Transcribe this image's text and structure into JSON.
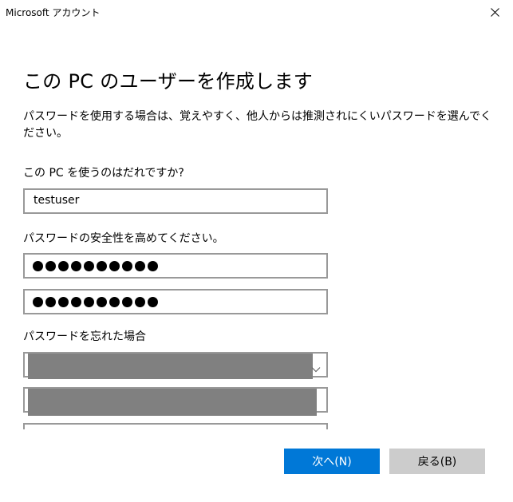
{
  "window": {
    "title": "Microsoft アカウント",
    "close_icon": "close-icon"
  },
  "page": {
    "heading": "この PC のユーザーを作成します",
    "description": "パスワードを使用する場合は、覚えやすく、他人からは推測されにくいパスワードを選んでください。"
  },
  "user": {
    "label": "この PC を使うのはだれですか?",
    "username_value": "testuser"
  },
  "password": {
    "label": "パスワードの安全性を高めてください。",
    "password_mask": "●●●●●●●●●●",
    "confirm_mask": "●●●●●●●●●●"
  },
  "recovery": {
    "label": "パスワードを忘れた場合",
    "question_icon": "chevron-down-icon"
  },
  "buttons": {
    "next_label": "次へ(N)",
    "back_label": "戻る(B)"
  },
  "colors": {
    "primary_button": "#0078d7",
    "secondary_button": "#cccccc",
    "field_border": "#999999",
    "redaction": "#808080"
  }
}
